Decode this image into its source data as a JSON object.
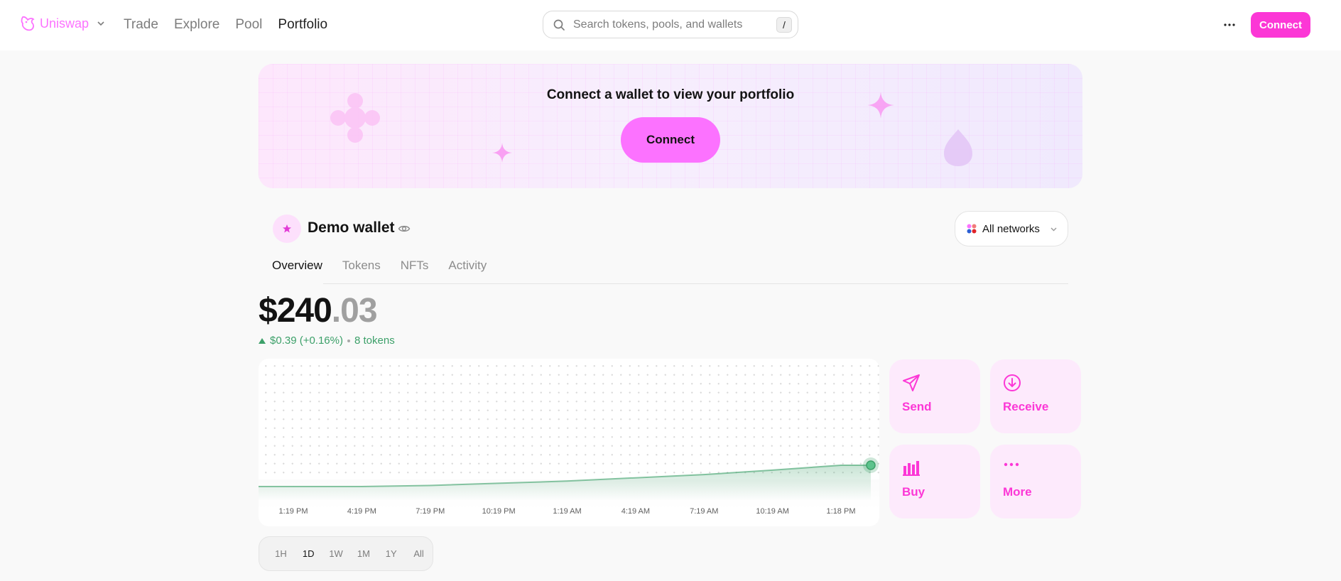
{
  "header": {
    "brand": "Uniswap",
    "nav": [
      {
        "label": "Trade"
      },
      {
        "label": "Explore"
      },
      {
        "label": "Pool"
      },
      {
        "label": "Portfolio",
        "active": true
      }
    ],
    "search": {
      "placeholder": "Search tokens, pools, and wallets",
      "shortcut": "/"
    },
    "connect_label": "Connect"
  },
  "banner": {
    "title": "Connect a wallet to view your portfolio",
    "connect_label": "Connect"
  },
  "wallet": {
    "name": "Demo wallet",
    "networks_label": "All networks"
  },
  "tabs": [
    {
      "label": "Overview",
      "active": true
    },
    {
      "label": "Tokens"
    },
    {
      "label": "NFTs"
    },
    {
      "label": "Activity"
    }
  ],
  "balance": {
    "whole": "$240",
    "cents": ".03",
    "change": "$0.39 (+0.16%)",
    "tokens": "8 tokens"
  },
  "chart_data": {
    "type": "line",
    "x": [
      "1:19 PM",
      "4:19 PM",
      "7:19 PM",
      "10:19 PM",
      "1:19 AM",
      "4:19 AM",
      "7:19 AM",
      "10:19 AM",
      "1:18 PM"
    ],
    "values": [
      239.64,
      239.64,
      239.66,
      239.7,
      239.74,
      239.8,
      239.86,
      239.94,
      240.03
    ],
    "title": "",
    "xlabel": "",
    "ylabel": "",
    "color": "#3ca069"
  },
  "actions": [
    {
      "label": "Send",
      "icon": "send-icon"
    },
    {
      "label": "Receive",
      "icon": "receive-icon"
    },
    {
      "label": "Buy",
      "icon": "buy-icon"
    },
    {
      "label": "More",
      "icon": "more-icon"
    }
  ],
  "ranges": [
    {
      "label": "1H"
    },
    {
      "label": "1D",
      "active": true
    },
    {
      "label": "1W"
    },
    {
      "label": "1M"
    },
    {
      "label": "1Y"
    },
    {
      "label": "All"
    }
  ],
  "colors": {
    "accent": "#fc37d6",
    "accent_light": "#fc72ff",
    "positive": "#3ca069"
  }
}
